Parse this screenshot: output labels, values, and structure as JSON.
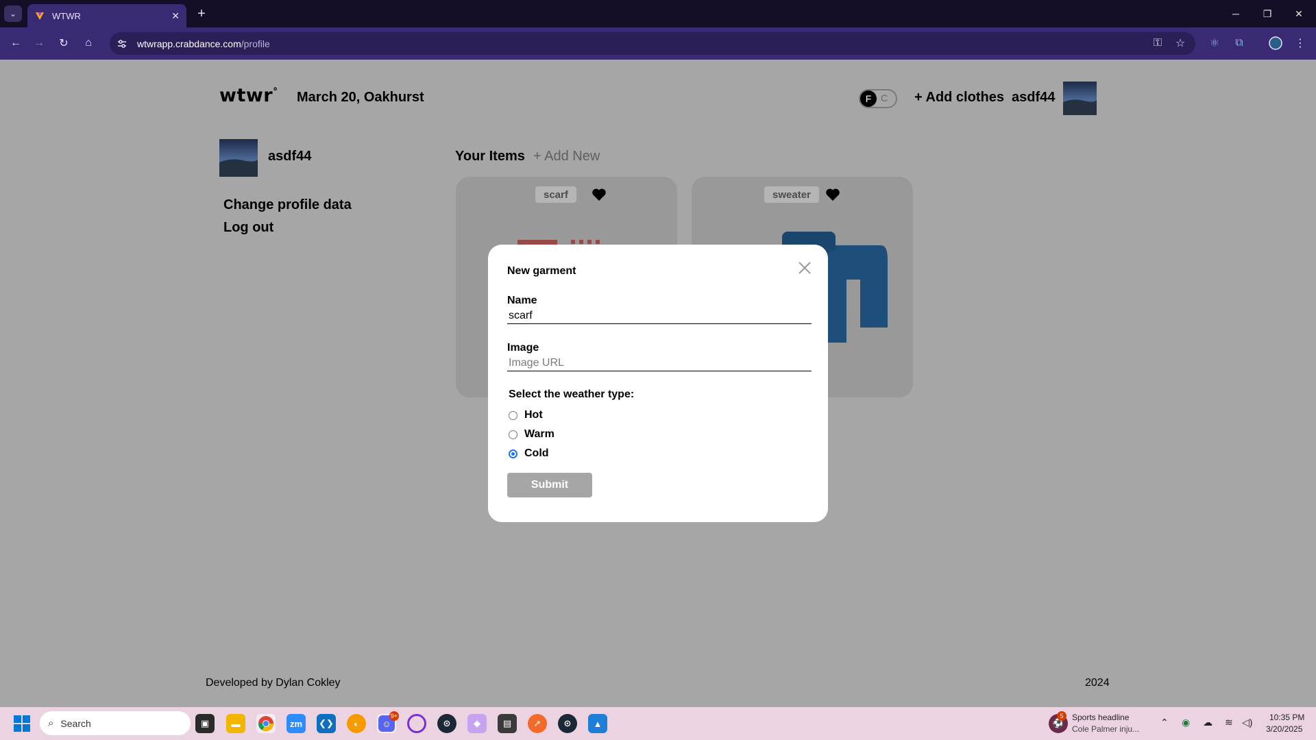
{
  "browser": {
    "tab_title": "WTWR",
    "url_host": "wtwrapp.crabdance.com",
    "url_path": "/profile",
    "accent": "#3a2a74"
  },
  "header": {
    "logo": "wtwr",
    "logo_mark": "°",
    "date_location": "March 20, Oakhurst",
    "toggle_on": "F",
    "toggle_off": "C",
    "add_clothes": "+ Add clothes",
    "username": "asdf44"
  },
  "sidebar": {
    "username": "asdf44",
    "change_profile": "Change profile data",
    "log_out": "Log out"
  },
  "items": {
    "title": "Your Items",
    "add_new": "+ Add New",
    "cards": [
      {
        "name": "scarf"
      },
      {
        "name": "sweater"
      }
    ]
  },
  "modal": {
    "title": "New garment",
    "name_label": "Name",
    "name_value": "scarf",
    "image_label": "Image",
    "image_placeholder": "Image URL",
    "weather_label": "Select the weather type:",
    "options": [
      {
        "label": "Hot",
        "checked": false
      },
      {
        "label": "Warm",
        "checked": false
      },
      {
        "label": "Cold",
        "checked": true
      }
    ],
    "submit": "Submit"
  },
  "footer": {
    "developer": "Developed by Dylan Cokley",
    "year": "2024"
  },
  "taskbar": {
    "search": "Search",
    "news_headline": "Sports headline",
    "news_sub": "Cole Palmer inju...",
    "news_badge": "5",
    "discord_badge": "9+",
    "time": "10:35 PM",
    "date": "3/20/2025"
  }
}
